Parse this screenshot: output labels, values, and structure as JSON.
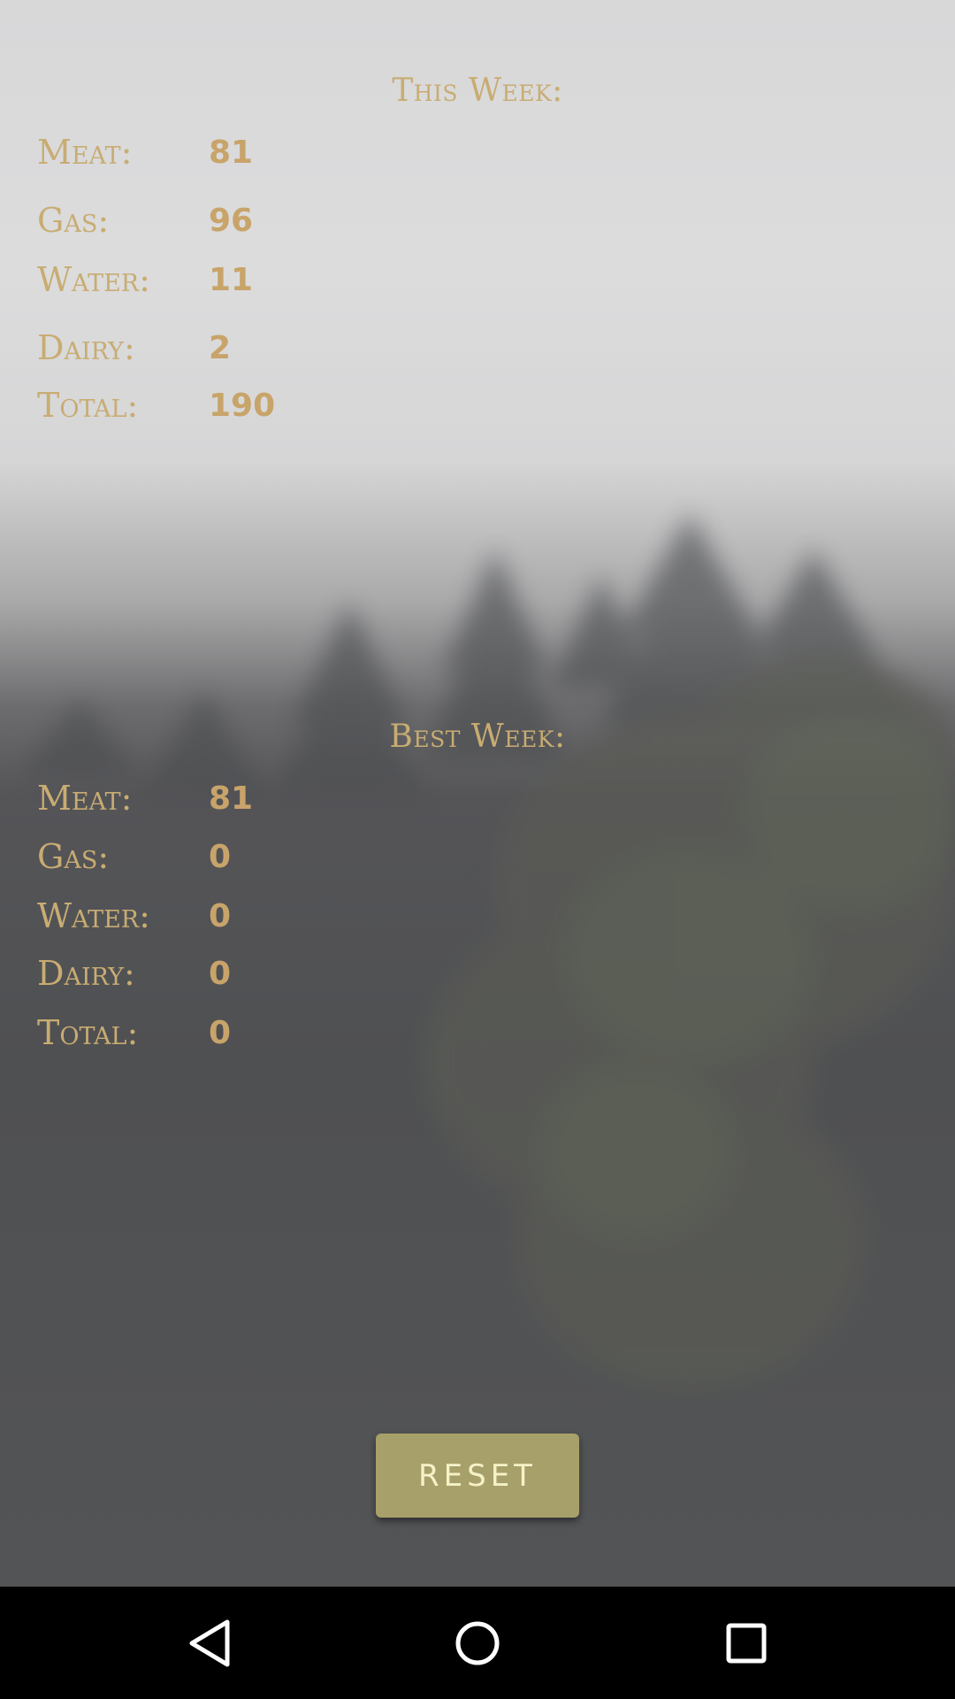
{
  "this_week": {
    "title": "This Week:",
    "rows": [
      {
        "label": "Meat:",
        "value": "81"
      },
      {
        "label": "Gas:",
        "value": "96"
      },
      {
        "label": "Water:",
        "value": "11"
      },
      {
        "label": "Dairy:",
        "value": "2"
      },
      {
        "label": "Total:",
        "value": "190"
      }
    ]
  },
  "best_week": {
    "title": "Best Week:",
    "rows": [
      {
        "label": "Meat:",
        "value": "81"
      },
      {
        "label": "Gas:",
        "value": "0"
      },
      {
        "label": "Water:",
        "value": "0"
      },
      {
        "label": "Dairy:",
        "value": "0"
      },
      {
        "label": "Total:",
        "value": "0"
      }
    ]
  },
  "reset_label": "RESET",
  "nav": {
    "back_icon": "back-triangle",
    "home_icon": "home-circle",
    "recents_icon": "recents-square"
  },
  "colors": {
    "accent_text": "#c8ac72",
    "button_bg": "#a8a06a",
    "button_text": "#f6f2c8"
  }
}
